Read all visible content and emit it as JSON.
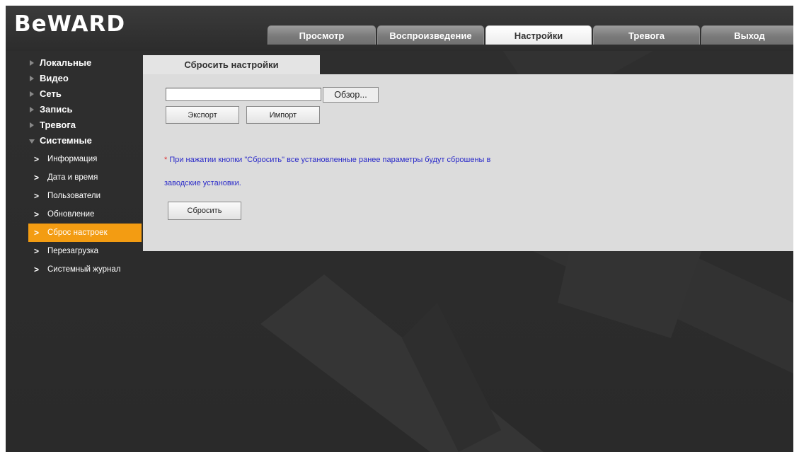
{
  "app": {
    "logo": "BeWARD"
  },
  "tabs": [
    "Просмотр",
    "Воспроизведение",
    "Настройки",
    "Тревога",
    "Выход"
  ],
  "active_tab": "Настройки",
  "sidebar": {
    "sections": [
      {
        "label": "Локальные"
      },
      {
        "label": "Видео"
      },
      {
        "label": "Сеть"
      },
      {
        "label": "Запись"
      },
      {
        "label": "Тревога"
      },
      {
        "label": "Системные"
      }
    ],
    "system_items": [
      {
        "label": "Информация"
      },
      {
        "label": "Дата и время"
      },
      {
        "label": "Пользователи"
      },
      {
        "label": "Обновление"
      },
      {
        "label": "Сброс настроек"
      },
      {
        "label": "Перезагрузка"
      },
      {
        "label": "Системный журнал"
      }
    ],
    "active_item": "Сброс настроек"
  },
  "content": {
    "tab_title": "Сбросить настройки",
    "file_input_value": "",
    "browse_label": "Обзор...",
    "export_label": "Экспорт",
    "import_label": "Импорт",
    "note_star": "*",
    "note_line1": " При нажатии кнопки \"Сбросить\" все установленные ранее параметры будут сброшены в",
    "note_line2": "заводские установки.",
    "reset_label": "Сбросить"
  },
  "colors": {
    "accent": "#f39c12",
    "note_text": "#2b2bc9",
    "panel_bg": "#dcdcdc"
  }
}
